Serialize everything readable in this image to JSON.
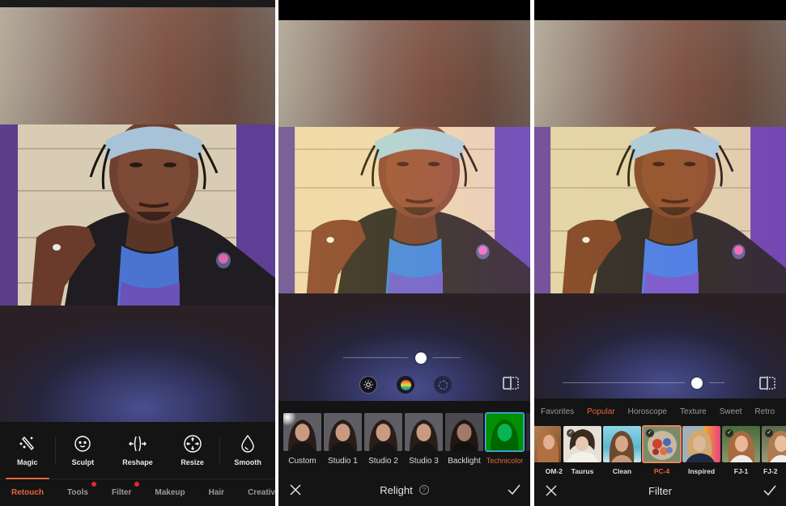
{
  "accent_color": "#e8663a",
  "panel_retouch": {
    "tools": [
      {
        "label": "Magic",
        "icon": "magic-wand-icon"
      },
      {
        "label": "Sculpt",
        "icon": "face-icon"
      },
      {
        "label": "Reshape",
        "icon": "reshape-icon"
      },
      {
        "label": "Resize",
        "icon": "resize-icon"
      },
      {
        "label": "Smooth",
        "icon": "droplet-icon"
      }
    ],
    "categories": [
      {
        "label": "Retouch",
        "active": true,
        "badge": false
      },
      {
        "label": "Tools",
        "active": false,
        "badge": true
      },
      {
        "label": "Filter",
        "active": false,
        "badge": true
      },
      {
        "label": "Makeup",
        "active": false,
        "badge": false
      },
      {
        "label": "Hair",
        "active": false,
        "badge": false
      },
      {
        "label": "Creative",
        "active": false,
        "badge": false
      }
    ]
  },
  "panel_relight": {
    "slider_value": 0.66,
    "modes": [
      {
        "name": "brightness",
        "icon": "sun-icon",
        "active": true
      },
      {
        "name": "color",
        "icon": "rainbow-icon",
        "active": false
      },
      {
        "name": "ring",
        "icon": "ring-icon",
        "active": false
      }
    ],
    "presets": [
      {
        "label": "Custom",
        "selected": false
      },
      {
        "label": "Studio 1",
        "selected": false
      },
      {
        "label": "Studio 2",
        "selected": false
      },
      {
        "label": "Studio 3",
        "selected": false
      },
      {
        "label": "Backlight",
        "selected": false
      },
      {
        "label": "Technicolor",
        "selected": true
      }
    ],
    "title": "Relight",
    "help_glyph": "?",
    "cancel_icon": "close-icon",
    "apply_icon": "checkmark-icon"
  },
  "panel_filter": {
    "slider_value": 0.83,
    "tabs": [
      {
        "label": "Favorites",
        "active": false
      },
      {
        "label": "Popular",
        "active": true
      },
      {
        "label": "Horoscope",
        "active": false
      },
      {
        "label": "Texture",
        "active": false
      },
      {
        "label": "Sweet",
        "active": false
      },
      {
        "label": "Retro",
        "active": false
      }
    ],
    "filters": [
      {
        "label": "OM-2",
        "selected": false,
        "checked": false
      },
      {
        "label": "Taurus",
        "selected": false,
        "checked": true
      },
      {
        "label": "Clean",
        "selected": false,
        "checked": false
      },
      {
        "label": "PC-4",
        "selected": true,
        "checked": true
      },
      {
        "label": "Inspired",
        "selected": false,
        "checked": false
      },
      {
        "label": "FJ-1",
        "selected": false,
        "checked": true
      },
      {
        "label": "FJ-2",
        "selected": false,
        "checked": true
      }
    ],
    "title": "Filter",
    "check_glyph": "✓"
  }
}
